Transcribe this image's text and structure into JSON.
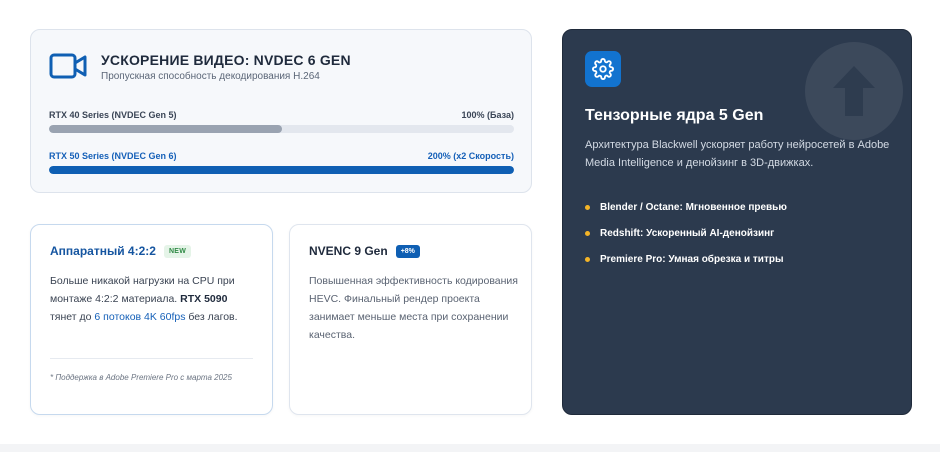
{
  "nvdec": {
    "title": "УСКОРЕНИЕ ВИДЕО: NVDEC 6 GEN",
    "subtitle": "Пропускная способность декодирования H.264",
    "icon": "video-camera-icon",
    "accent": "#0f5fb3",
    "bars": [
      {
        "label": "RTX 40 Series (NVDEC Gen 5)",
        "value_text": "100% (База)",
        "fill_fraction": 0.5,
        "color": "#9aa3b1"
      },
      {
        "label": "RTX 50 Series (NVDEC Gen 6)",
        "value_text": "200% (x2 Скорость)",
        "fill_fraction": 1.0,
        "color": "#0f5fb3"
      }
    ]
  },
  "card_422": {
    "title": "Аппаратный 4:2:2",
    "badge": "NEW",
    "body_part1": "Больше никакой нагрузки на CPU при монтаже 4:2:2 материала. ",
    "body_bold": "RTX 5090",
    "body_part2": " тянет до ",
    "body_highlight": "6 потоков 4K 60fps",
    "body_part3": " без лагов.",
    "note": "* Поддержка в Adobe Premiere Pro с марта 2025"
  },
  "card_nvenc": {
    "title": "NVENC 9 Gen",
    "badge": "+8%",
    "body": "Повышенная эффективность кодирования HEVC. Финальный рендер проекта занимает меньше места при сохранении качества."
  },
  "tensor": {
    "icon": "gear-icon",
    "decor_icon": "arrow-up-icon",
    "title": "Тензорные ядра 5 Gen",
    "description": "Архитектура Blackwell ускоряет работу нейросетей в Adobe Media Intelligence и денойзинг в 3D-движках.",
    "bullet_color": "#f4b427",
    "items": [
      "Blender / Octane: Мгновенное превью",
      "Redshift: Ускоренный AI-денойзинг",
      "Premiere Pro: Умная обрезка и титры"
    ]
  }
}
